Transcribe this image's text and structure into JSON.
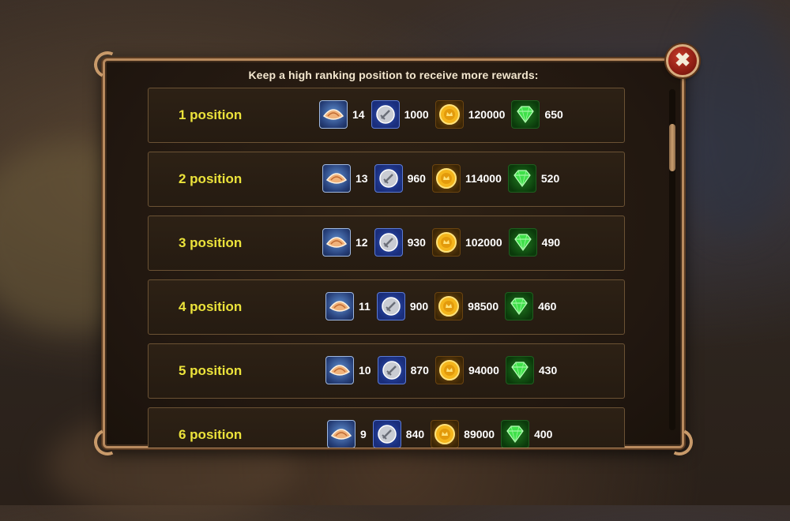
{
  "header": {
    "text": "Keep a high ranking position to receive more rewards:"
  },
  "icons": {
    "shell": "shell-icon",
    "scroll": "sword-scroll-icon",
    "gold": "gold-coin-icon",
    "gem": "emerald-icon",
    "close": "close-icon"
  },
  "colors": {
    "position_label": "#ece33b",
    "frame": "#b88a5e"
  },
  "rows": [
    {
      "label": "1 position",
      "rewards": [
        "14",
        "1000",
        "120000",
        "650"
      ]
    },
    {
      "label": "2 position",
      "rewards": [
        "13",
        "960",
        "114000",
        "520"
      ]
    },
    {
      "label": "3 position",
      "rewards": [
        "12",
        "930",
        "102000",
        "490"
      ]
    },
    {
      "label": "4 position",
      "rewards": [
        "11",
        "900",
        "98500",
        "460"
      ]
    },
    {
      "label": "5 position",
      "rewards": [
        "10",
        "870",
        "94000",
        "430"
      ]
    },
    {
      "label": "6 position",
      "rewards": [
        "9",
        "840",
        "89000",
        "400"
      ]
    }
  ]
}
